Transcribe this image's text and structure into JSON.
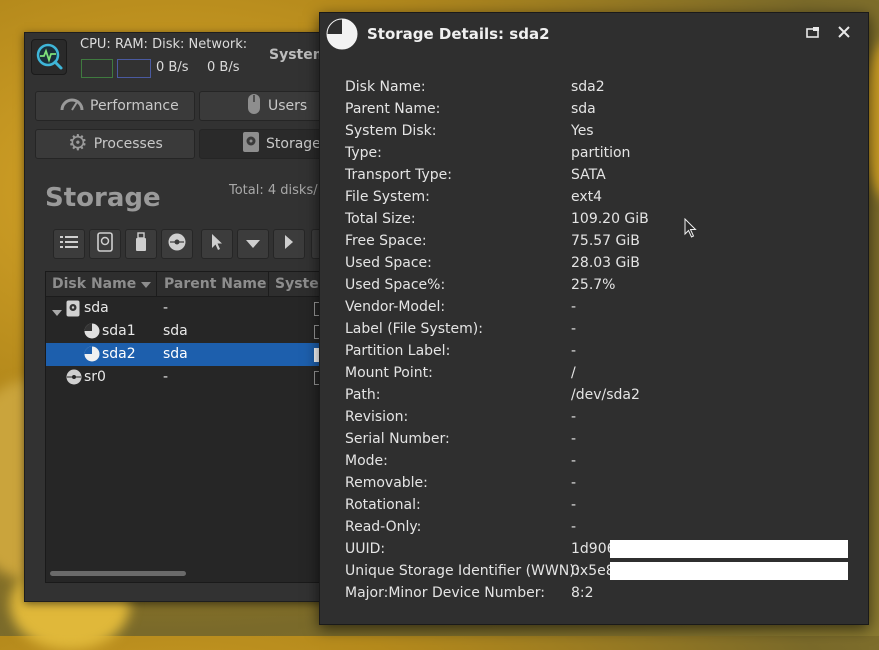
{
  "main": {
    "monitor_labels": "CPU: RAM: Disk: Network:",
    "net_down": "0 B/s",
    "net_up": "0 B/s",
    "system_label": "System",
    "tabs": [
      {
        "label": "Performance",
        "icon": "gauge-icon"
      },
      {
        "label": "Users",
        "icon": "mouse-icon"
      },
      {
        "label": "Processes",
        "icon": "gear-icon"
      },
      {
        "label": "Storage",
        "icon": "harddisk-icon"
      }
    ],
    "page_title": "Storage",
    "total_label": "Total: 4 disks/",
    "toolbar_icons": [
      "list-icon",
      "harddisk-icon",
      "usb-icon",
      "optical-icon",
      "pointer-icon",
      "dropdown-icon",
      "play-icon"
    ],
    "columns": [
      "Disk Name",
      "Parent Name",
      "Syste"
    ],
    "rows": [
      {
        "name": "sda",
        "parent": "-",
        "level": 0,
        "icon": "harddisk-icon",
        "expander": true
      },
      {
        "name": "sda1",
        "parent": "sda",
        "level": 1,
        "icon": "pie-icon",
        "expander": false
      },
      {
        "name": "sda2",
        "parent": "sda",
        "level": 1,
        "icon": "pie-icon",
        "expander": false,
        "selected": true
      },
      {
        "name": "sr0",
        "parent": "-",
        "level": 0,
        "icon": "optical-icon",
        "expander": false
      }
    ]
  },
  "dialog": {
    "title": "Storage Details: sda2",
    "properties": [
      {
        "label": "Disk Name:",
        "value": "sda2"
      },
      {
        "label": "Parent Name:",
        "value": "sda"
      },
      {
        "label": "System Disk:",
        "value": "Yes"
      },
      {
        "label": "Type:",
        "value": "partition"
      },
      {
        "label": "Transport Type:",
        "value": "SATA"
      },
      {
        "label": "File System:",
        "value": "ext4"
      },
      {
        "label": "Total Size:",
        "value": "109.20 GiB"
      },
      {
        "label": "Free Space:",
        "value": "75.57 GiB"
      },
      {
        "label": "Used Space:",
        "value": "28.03 GiB"
      },
      {
        "label": "Used Space%:",
        "value": "25.7%"
      },
      {
        "label": "Vendor-Model:",
        "value": "-"
      },
      {
        "label": "Label (File System):",
        "value": "-"
      },
      {
        "label": "Partition Label:",
        "value": "-"
      },
      {
        "label": "Mount Point:",
        "value": "/"
      },
      {
        "label": "Path:",
        "value": "/dev/sda2"
      },
      {
        "label": "Revision:",
        "value": "-"
      },
      {
        "label": "Serial Number:",
        "value": "-"
      },
      {
        "label": "Mode:",
        "value": "-"
      },
      {
        "label": "Removable:",
        "value": "-"
      },
      {
        "label": "Rotational:",
        "value": "-"
      },
      {
        "label": "Read-Only:",
        "value": "-"
      },
      {
        "label": "UUID:",
        "value": "1d906",
        "redacted": true
      },
      {
        "label": "Unique Storage Identifier (WWN):",
        "value": "0x5e8",
        "redacted": true
      },
      {
        "label": "Major:Minor Device Number:",
        "value": "8:2"
      }
    ]
  },
  "colors": {
    "selection": "#1d5fad",
    "window_bg": "#323232",
    "dialog_bg": "#2f2f2f"
  }
}
